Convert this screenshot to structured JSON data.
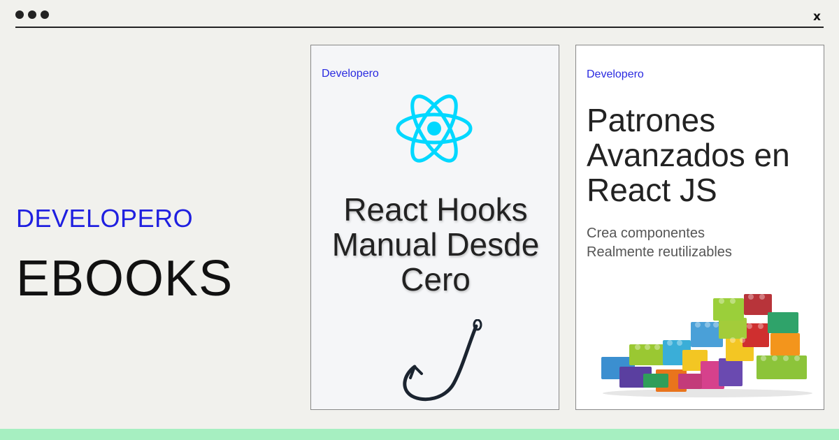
{
  "window": {
    "close_label": "x"
  },
  "hero": {
    "brand": "DEVELOPERO",
    "title": "EBOOKS"
  },
  "books": [
    {
      "publisher": "Developero",
      "title": "React Hooks Manual Desde Cero",
      "cover_icons": [
        "react-logo-icon",
        "hook-icon"
      ]
    },
    {
      "publisher": "Developero",
      "title": "Patrones Avanzados en React JS",
      "subtitle": "Crea componentes Realmente reutilizables",
      "cover_image": "lego-bricks-illustration"
    }
  ],
  "colors": {
    "background": "#f1f1ed",
    "brand_blue": "#1f1fe0",
    "react_cyan": "#00d8ff",
    "footer_green": "#a6efc1"
  }
}
